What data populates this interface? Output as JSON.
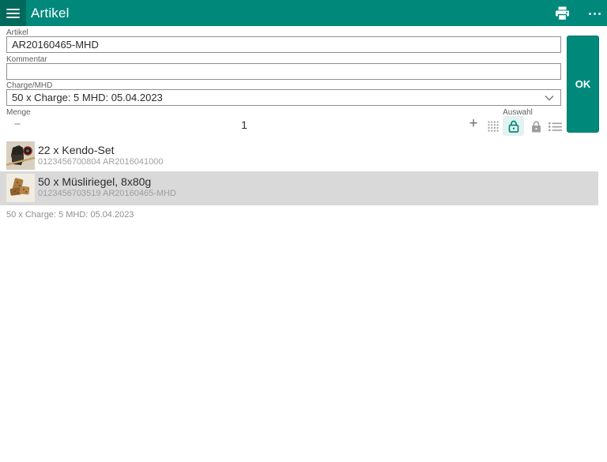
{
  "header": {
    "title": "Artikel",
    "icons": {
      "menu": "hamburger-menu",
      "print": "printer",
      "overflow": "horizontal-three-dots"
    }
  },
  "form": {
    "artikel": {
      "label": "Artikel",
      "value": "AR20160465-MHD"
    },
    "kommentar": {
      "label": "Kommentar",
      "value": ""
    },
    "charge": {
      "label": "Charge/MHD",
      "value": "50 x Charge: 5 MHD: 05.04.2023"
    },
    "menge": {
      "label": "Menge",
      "value": "1",
      "minus_glyph": "−",
      "plus_glyph": "+"
    },
    "auswahl_label": "Auswahl",
    "ok_label": "OK",
    "icons": {
      "dropdown": "chevron-down",
      "grid": "dots-grid",
      "lock_selected": "lock-teal-selected",
      "lock": "lock-gray",
      "list": "bullet-list"
    }
  },
  "list": {
    "items": [
      {
        "title": "22 x Kendo-Set",
        "subtitle": "0123456700804 AR2016041000",
        "selected": false
      },
      {
        "title": "50 x Müsliriegel, 8x80g",
        "subtitle": "0123456703519 AR20160465-MHD",
        "selected": true
      }
    ]
  },
  "status_text": "50 x Charge: 5 MHD: 05.04.2023",
  "colors": {
    "header_teal": "#00897B",
    "header_square_teal": "#00695C",
    "ok_button": "#00897B",
    "selected_row_bg": "#D9D9D9",
    "selected_icon_bg": "#E3F2F0",
    "icon_gray": "#9E9E9E",
    "border_gray": "#8F8F8F"
  }
}
